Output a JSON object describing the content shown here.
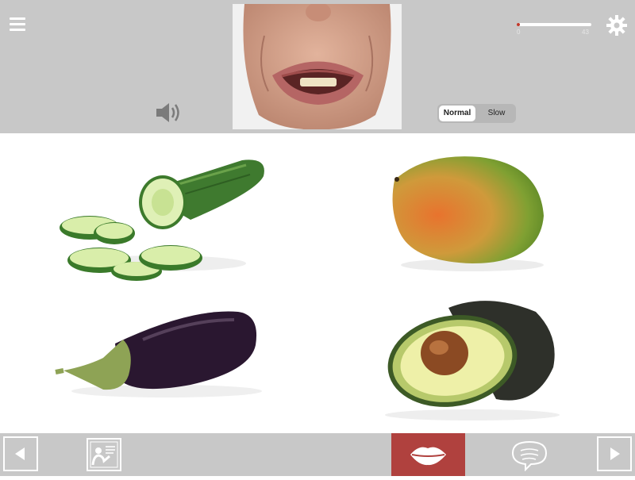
{
  "header": {
    "menu_icon": "hamburger-menu-icon",
    "speaker_icon": "speaker-icon",
    "settings_icon": "gear-icon",
    "speed": {
      "options": [
        "Normal",
        "Slow"
      ],
      "selected": "Normal"
    },
    "progress": {
      "min_label": "0",
      "max_label": "43",
      "current": 1,
      "total": 43
    }
  },
  "video": {
    "description": "speaker-mouth-video"
  },
  "choices": [
    {
      "id": "cucumber"
    },
    {
      "id": "mango"
    },
    {
      "id": "eggplant"
    },
    {
      "id": "avocado"
    }
  ],
  "footer": {
    "prev_icon": "triangle-left-icon",
    "teacher_icon": "teacher-board-icon",
    "lips_icon": "lips-icon",
    "speech_icon": "speech-bubble-icon",
    "next_icon": "triangle-right-icon"
  },
  "colors": {
    "bar": "#c8c8c8",
    "accent": "#b0413e",
    "progress": "#c0392b"
  }
}
